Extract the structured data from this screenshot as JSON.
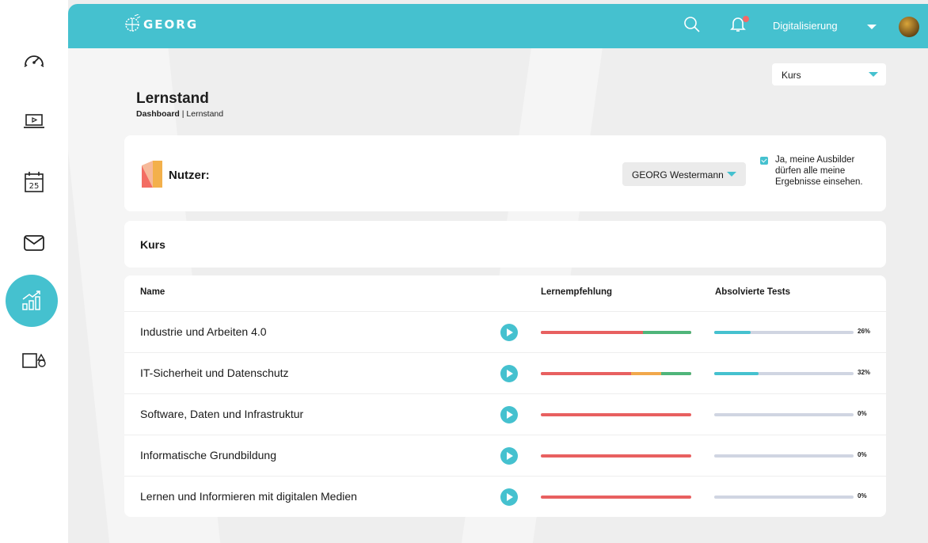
{
  "brand": {
    "name": "GEORG",
    "accent": "#45c1cf",
    "red": "#e86060",
    "orange": "#f1a84b",
    "green": "#4fb57a"
  },
  "sidebar": {
    "items": [
      {
        "icon": "speedometer-icon"
      },
      {
        "icon": "video-player-icon"
      },
      {
        "icon": "calendar-icon",
        "label": "25"
      },
      {
        "icon": "mail-icon"
      },
      {
        "icon": "chart-icon",
        "active": true
      },
      {
        "icon": "shapes-icon"
      }
    ]
  },
  "header": {
    "user_name": "Digitalisierung",
    "notifications_unread": true
  },
  "course_select": {
    "value": "Kurs"
  },
  "page": {
    "title": "Lernstand",
    "breadcrumb_root": "Dashboard",
    "breadcrumb_separator": " | ",
    "breadcrumb_current": "Lernstand"
  },
  "user_card": {
    "label": "Nutzer:",
    "selected_user": "GEORG Westermann",
    "consent_text": "Ja, meine Ausbilder dürfen alle meine Ergebnisse einsehen.",
    "consent_checked": true
  },
  "kurs_card": {
    "title": "Kurs"
  },
  "table": {
    "headers": {
      "name": "Name",
      "recommendation": "Lernempfehlung",
      "tests": "Absolvierte Tests"
    },
    "rows": [
      {
        "name": "Industrie und Arbeiten 4.0",
        "recommendation": {
          "red": 0.68,
          "orange": 0,
          "green": 0.32
        },
        "progress": 0.26,
        "progress_label": "26%"
      },
      {
        "name": "IT-Sicherheit und Datenschutz",
        "recommendation": {
          "red": 0.6,
          "orange": 0.2,
          "green": 0.2
        },
        "progress": 0.32,
        "progress_label": "32%"
      },
      {
        "name": "Software, Daten und Infrastruktur",
        "recommendation": {
          "red": 1,
          "orange": 0,
          "green": 0
        },
        "progress": 0,
        "progress_label": "0%"
      },
      {
        "name": "Informatische Grundbildung",
        "recommendation": {
          "red": 1,
          "orange": 0,
          "green": 0
        },
        "progress": 0,
        "progress_label": "0%"
      },
      {
        "name": "Lernen und Informieren mit digitalen Medien",
        "recommendation": {
          "red": 1,
          "orange": 0,
          "green": 0
        },
        "progress": 0,
        "progress_label": "0%"
      }
    ]
  }
}
